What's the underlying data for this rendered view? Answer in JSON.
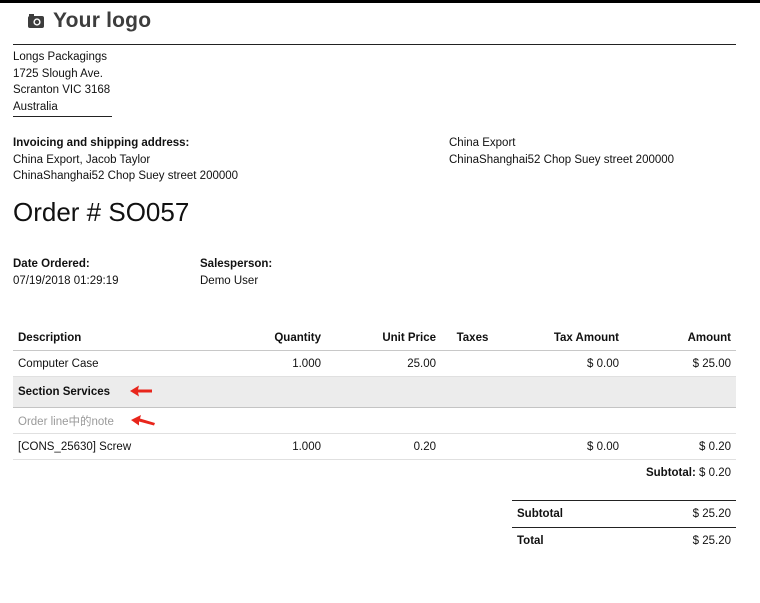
{
  "logo": {
    "text": "Your logo",
    "icon": "camera-icon"
  },
  "company": {
    "name": "Longs Packagings",
    "street": "1725 Slough Ave.",
    "city": "Scranton VIC 3168",
    "country": "Australia"
  },
  "invoicing": {
    "heading": "Invoicing and shipping address:",
    "name": "China Export, Jacob Taylor",
    "address": "ChinaShanghai52 Chop Suey street 200000"
  },
  "customer": {
    "name": "China Export",
    "address": "ChinaShanghai52 Chop Suey street 200000"
  },
  "order": {
    "title": "Order # SO057"
  },
  "info": {
    "date_label": "Date Ordered:",
    "date_value": "07/19/2018 01:29:19",
    "sales_label": "Salesperson:",
    "sales_value": "Demo User"
  },
  "table": {
    "headers": {
      "description": "Description",
      "quantity": "Quantity",
      "unit_price": "Unit Price",
      "taxes": "Taxes",
      "tax_amount": "Tax Amount",
      "amount": "Amount"
    },
    "rows": [
      {
        "description": "Computer Case",
        "quantity": "1.000",
        "unit_price": "25.00",
        "taxes": "",
        "tax_amount": "$ 0.00",
        "amount": "$ 25.00"
      }
    ],
    "section": "Section Services",
    "note": "Order line中的note",
    "rows2": [
      {
        "description": "[CONS_25630] Screw",
        "quantity": "1.000",
        "unit_price": "0.20",
        "taxes": "",
        "tax_amount": "$ 0.00",
        "amount": "$ 0.20"
      }
    ],
    "subtotal_label": "Subtotal:",
    "subtotal_value": "$ 0.20"
  },
  "totals": {
    "subtotal_label": "Subtotal",
    "subtotal_value": "$ 25.20",
    "total_label": "Total",
    "total_value": "$ 25.20"
  },
  "colors": {
    "arrow": "#e8261c",
    "section_bg": "#ececec"
  }
}
